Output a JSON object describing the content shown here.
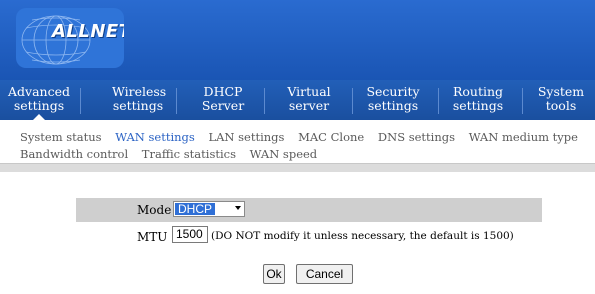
{
  "brand": {
    "name": "ALLNET",
    "registered_mark": "®",
    "colors": {
      "header": "#1f5fbf",
      "nav": "#1d58b0",
      "link_active": "#2a62c4",
      "select_highlight": "#2f6fd6"
    }
  },
  "nav": {
    "items": [
      {
        "line1": "Advanced",
        "line2": "settings"
      },
      {
        "line1": "Wireless",
        "line2": "settings"
      },
      {
        "line1": "DHCP",
        "line2": "Server"
      },
      {
        "line1": "Virtual",
        "line2": "server"
      },
      {
        "line1": "Security",
        "line2": "settings"
      },
      {
        "line1": "Routing",
        "line2": "settings"
      },
      {
        "line1": "System",
        "line2": "tools"
      }
    ],
    "active_index": 0
  },
  "subnav": {
    "row1": [
      "System status",
      "WAN settings",
      "LAN settings",
      "MAC Clone",
      "DNS settings",
      "WAN medium type"
    ],
    "row2": [
      "Bandwidth control",
      "Traffic statistics",
      "WAN speed"
    ],
    "current": "WAN settings"
  },
  "form": {
    "mode_label": "Mode",
    "mode_value": "DHCP",
    "mtu_label": "MTU",
    "mtu_value": "1500",
    "mtu_note": "(DO NOT modify it unless necessary, the default is 1500)"
  },
  "buttons": {
    "ok": "Ok",
    "cancel": "Cancel"
  },
  "icons": {
    "logo": "allnet-globe-logo",
    "dropdown": "chevron-down-icon"
  }
}
